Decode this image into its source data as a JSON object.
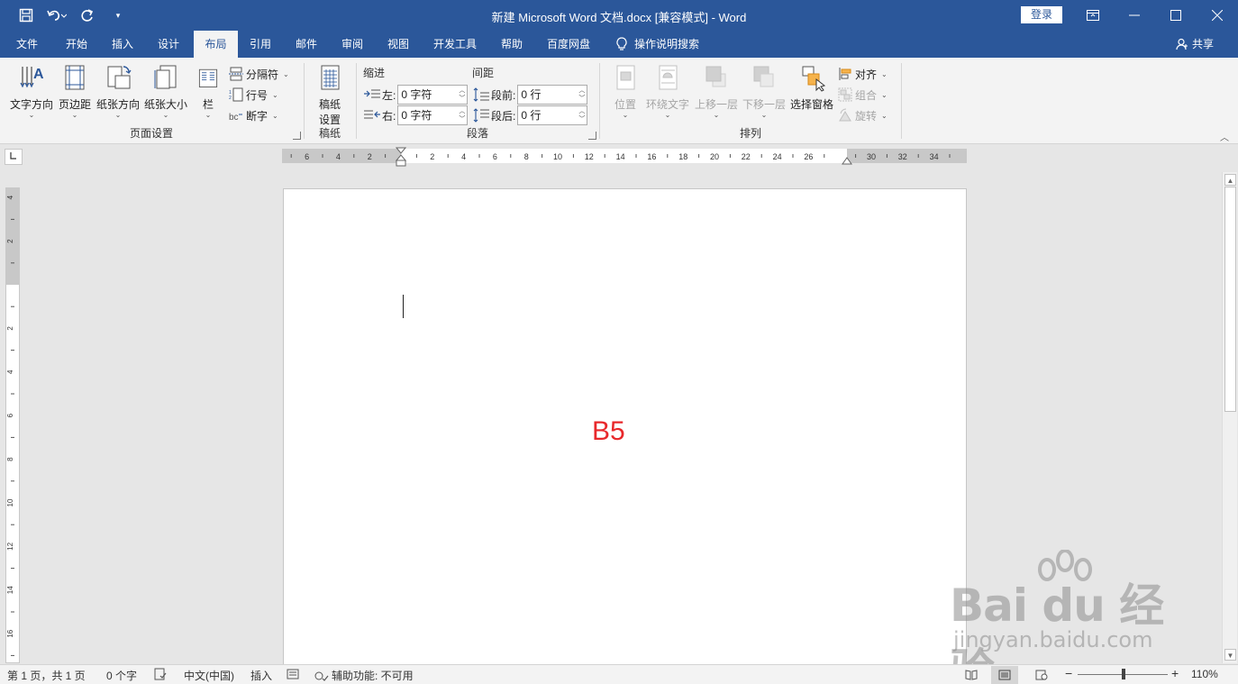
{
  "window": {
    "title": "新建 Microsoft Word 文档.docx [兼容模式]  -  Word",
    "login": "登录"
  },
  "tabs": [
    "文件",
    "开始",
    "插入",
    "设计",
    "布局",
    "引用",
    "邮件",
    "审阅",
    "视图",
    "开发工具",
    "帮助",
    "百度网盘"
  ],
  "active_tab": "布局",
  "search_tab": "操作说明搜索",
  "share": "共享",
  "ribbon": {
    "page_setup": {
      "label": "页面设置",
      "text_direction": "文字方向",
      "margins": "页边距",
      "orientation": "纸张方向",
      "size": "纸张大小",
      "columns": "栏",
      "breaks": "分隔符",
      "line_numbers": "行号",
      "hyphenation": "断字"
    },
    "manuscript": {
      "label": "稿纸",
      "btn_line1": "稿纸",
      "btn_line2": "设置"
    },
    "paragraph": {
      "label": "段落",
      "indent_head": "缩进",
      "spacing_head": "间距",
      "left_label": "左:",
      "left_value": "0 字符",
      "right_label": "右:",
      "right_value": "0 字符",
      "before_label": "段前:",
      "before_value": "0 行",
      "after_label": "段后:",
      "after_value": "0 行"
    },
    "arrange": {
      "label": "排列",
      "position": "位置",
      "wrap_text": "环绕文字",
      "bring_forward": "上移一层",
      "send_backward": "下移一层",
      "selection_pane": "选择窗格",
      "align": "对齐",
      "group": "组合",
      "rotate": "旋转"
    }
  },
  "ruler": {
    "h_left_ticks": [
      "6",
      "4",
      "2"
    ],
    "h_right_ticks": [
      "2",
      "4",
      "6",
      "8",
      "10",
      "12",
      "14",
      "16",
      "18",
      "20",
      "22",
      "24",
      "26",
      "30",
      "32",
      "34"
    ],
    "v_top_ticks": [
      "4",
      "2"
    ],
    "v_ticks": [
      "2",
      "4",
      "6",
      "8",
      "10",
      "12",
      "14",
      "16"
    ]
  },
  "document": {
    "text": "B5"
  },
  "watermark": {
    "main": "Bai  du 经验",
    "sub": "jingyan.baidu.com"
  },
  "status": {
    "page": "第 1 页，共 1 页",
    "words": "0 个字",
    "language": "中文(中国)",
    "insert_mode": "插入",
    "accessibility": "辅助功能: 不可用",
    "zoom": "110%",
    "zoom_fraction": 0.5
  },
  "colors": {
    "title_bar": "#2b579a",
    "doc_text": "#e8282b"
  }
}
